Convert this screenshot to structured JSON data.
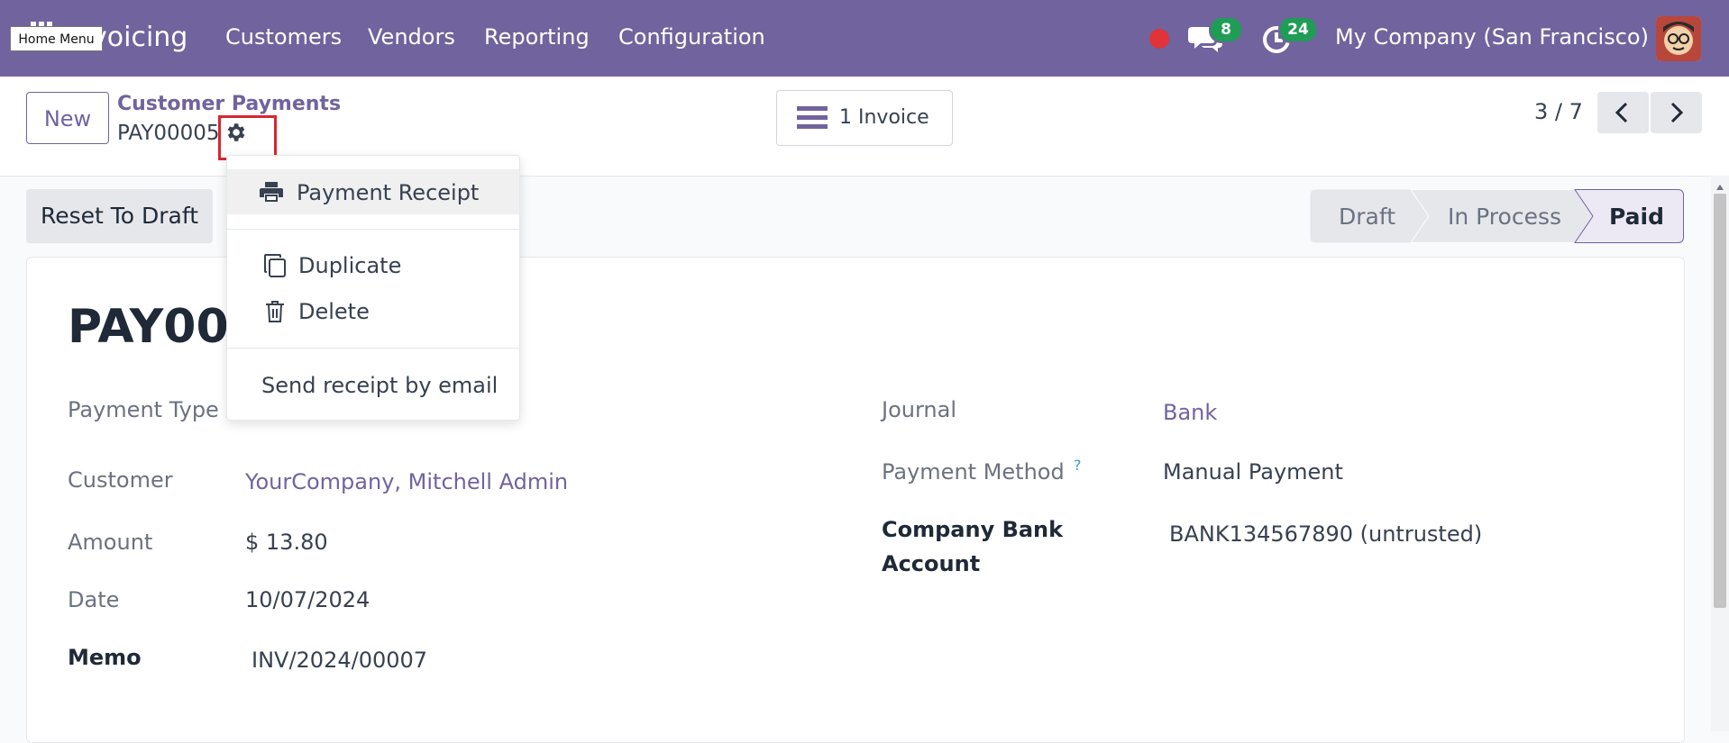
{
  "nav": {
    "app_title": "voicing",
    "tooltip": "Home Menu",
    "menu": [
      "Customers",
      "Vendors",
      "Reporting",
      "Configuration"
    ],
    "messages_count": "8",
    "activities_count": "24",
    "company": "My Company (San Francisco)"
  },
  "control": {
    "new_label": "New",
    "breadcrumb_parent": "Customer Payments",
    "record_name": "PAY00005",
    "invoice_button": "1 Invoice",
    "pager": "3 / 7"
  },
  "status": {
    "reset_label": "Reset To Draft",
    "stages": [
      "Draft",
      "In Process",
      "Paid"
    ],
    "active_stage": "Paid"
  },
  "dropdown": {
    "payment_receipt": "Payment Receipt",
    "duplicate": "Duplicate",
    "delete": "Delete",
    "send_receipt": "Send receipt by email"
  },
  "form": {
    "title": "PAY0000",
    "payment_type_label": "Payment Type",
    "customer_label": "Customer",
    "customer_value": "YourCompany, Mitchell Admin",
    "amount_label": "Amount",
    "amount_value": "$ 13.80",
    "date_label": "Date",
    "date_value": "10/07/2024",
    "memo_label": "Memo",
    "memo_value": "INV/2024/00007",
    "journal_label": "Journal",
    "journal_value": "Bank",
    "payment_method_label": "Payment Method",
    "payment_method_help": "?",
    "payment_method_value": "Manual Payment",
    "bank_account_label_1": "Company Bank",
    "bank_account_label_2": "Account",
    "bank_account_value": "BANK134567890 (untrusted)"
  },
  "colors": {
    "brand": "#71639e",
    "badge": "#1f9d55",
    "highlight": "#d8262f"
  }
}
